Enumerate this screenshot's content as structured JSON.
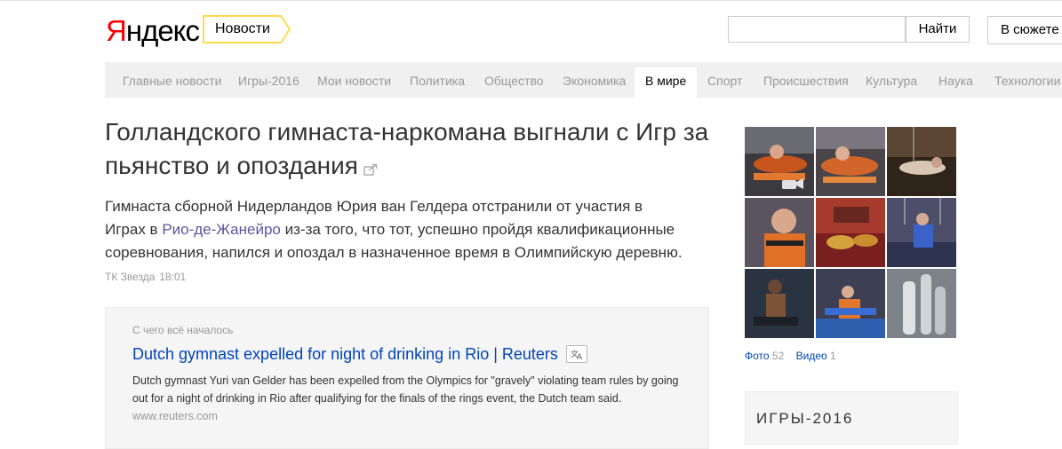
{
  "header": {
    "logo_ya": "Я",
    "logo_rest": "ндекс",
    "service": "Новости",
    "search_placeholder": "",
    "search_button": "Найти",
    "story_button": "В сюжете"
  },
  "nav": {
    "items": [
      {
        "label": "Главные новости"
      },
      {
        "label": "Игры-2016"
      },
      {
        "label": "Мои новости"
      },
      {
        "label": "Политика"
      },
      {
        "label": "Общество"
      },
      {
        "label": "Экономика"
      },
      {
        "label": "В мире",
        "active": true
      },
      {
        "label": "Спорт"
      },
      {
        "label": "Происшествия"
      },
      {
        "label": "Культура"
      },
      {
        "label": "Наука"
      },
      {
        "label": "Технологии"
      }
    ]
  },
  "article": {
    "headline": "Голландского гимнаста-наркомана выгнали с Игр за пьянство и опоздания",
    "lead_before": "Гимнаста сборной Нидерландов Юрия ван Гелдера отстранили от участия в Играх в ",
    "lead_geo": "Рио-де-Жанейро",
    "lead_after": " из-за того, что тот, успешно пройдя квалификационные соревнования, напился и опоздал в назначенное время в Олимпийскую деревню.",
    "source": "ТК Звезда",
    "time": "18:01"
  },
  "origin": {
    "label": "С чего всё началось",
    "title": "Dutch gymnast expelled for night of drinking in Rio | Reuters",
    "text": "Dutch gymnast Yuri van Gelder has been expelled from the Olympics for \"gravely\" violating team rules by going out for a night of drinking in Rio after qualifying for the finals of the rings event, the Dutch team said.",
    "domain": "www.reuters.com"
  },
  "media": {
    "photo_label": "Фото",
    "photo_count": "52",
    "video_label": "Видео",
    "video_count": "1"
  },
  "sidebar": {
    "games_title": "ИГРЫ-2016"
  },
  "colors": {
    "link": "#0044bb",
    "tag_border": "#ffdb4d",
    "nav_bg": "#f0f0f0"
  }
}
